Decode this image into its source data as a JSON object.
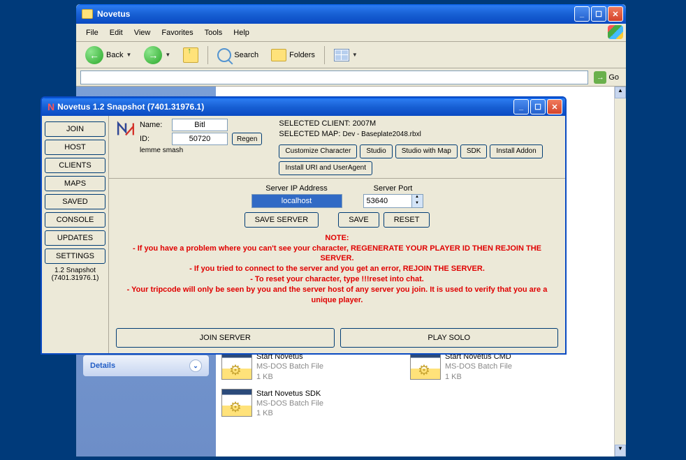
{
  "explorer": {
    "title": "Novetus",
    "menu": [
      "File",
      "Edit",
      "View",
      "Favorites",
      "Tools",
      "Help"
    ],
    "back": "Back",
    "search": "Search",
    "folders": "Folders",
    "go": "Go",
    "details": "Details",
    "files": [
      {
        "name": "Start Novetus",
        "type": "MS-DOS Batch File",
        "size": "1 KB"
      },
      {
        "name": "Start Novetus CMD",
        "type": "MS-DOS Batch File",
        "size": "1 KB"
      },
      {
        "name": "Start Novetus SDK",
        "type": "MS-DOS Batch File",
        "size": "1 KB"
      }
    ]
  },
  "app": {
    "title": "Novetus 1.2 Snapshot (7401.31976.1)",
    "name_label": "Name:",
    "name_value": "Bitl",
    "id_label": "ID:",
    "id_value": "50720",
    "regen": "Regen",
    "status": "lemme smash",
    "selected_client_label": "SELECTED CLIENT:",
    "selected_client": "2007M",
    "selected_map_label": "SELECTED MAP:",
    "selected_map": "Dev - Baseplate2048.rbxl",
    "tools": [
      "Customize Character",
      "Studio",
      "Studio with Map",
      "SDK",
      "Install Addon",
      "Install URI and UserAgent"
    ],
    "nav": [
      "JOIN",
      "HOST",
      "CLIENTS",
      "MAPS",
      "SAVED",
      "CONSOLE",
      "UPDATES",
      "SETTINGS"
    ],
    "version": "1.2 Snapshot (7401.31976.1)",
    "server_ip_label": "Server IP Address",
    "server_ip": "localhost",
    "server_port_label": "Server Port",
    "server_port": "53640",
    "save_server": "SAVE SERVER",
    "save": "SAVE",
    "reset": "RESET",
    "note_title": "NOTE:",
    "note1": "- If you have a problem where you can't see your character, REGENERATE YOUR PLAYER ID THEN REJOIN THE SERVER.",
    "note2": "- If you tried to connect to the server and you get an error, REJOIN THE SERVER.",
    "note3": "- To reset your character, type !!!reset into chat.",
    "note4": "- Your tripcode will only be seen by you and the server host of any server you join. It is used to verify that you are a unique player.",
    "join_server": "JOIN SERVER",
    "play_solo": "PLAY SOLO"
  }
}
